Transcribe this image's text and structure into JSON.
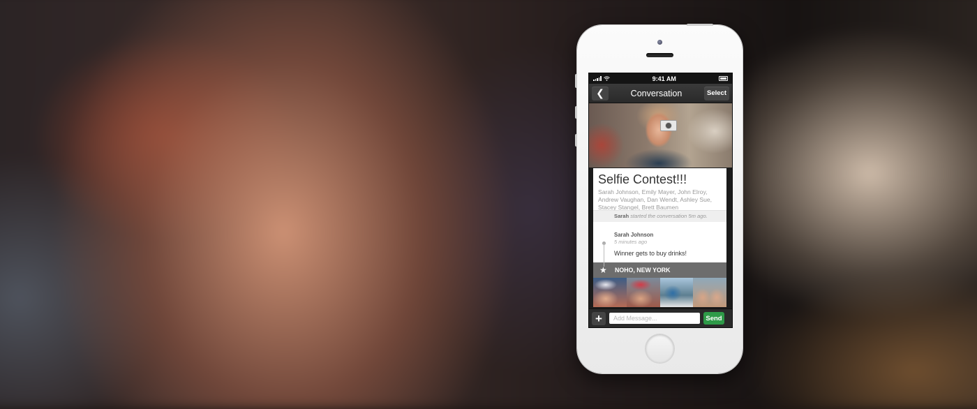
{
  "status_bar": {
    "time": "9:41 AM"
  },
  "nav": {
    "back_icon": "chevron-left-icon",
    "back_glyph": "❮",
    "title": "Conversation",
    "select_label": "Select"
  },
  "conversation": {
    "title": "Selfie Contest!!!",
    "members": "Sarah Johnson, Emily Mayer, John Elroy, Andrew Vaughan, Dan Wendt, Ashley Sue, Stacey Stangel, Brett Baumen",
    "started_by": "Sarah",
    "started_text": "started the conversation 5m ago."
  },
  "message": {
    "author": "Sarah Johnson",
    "time": "5 minutes ago",
    "text": "Winner gets to buy drinks!"
  },
  "location": {
    "icon": "star-icon",
    "glyph": "★",
    "label": "NOHO, NEW YORK"
  },
  "composer": {
    "add_glyph": "+",
    "placeholder": "Add Message...",
    "send_label": "Send"
  },
  "colors": {
    "send": "#2e9a48",
    "location_bar": "#6d6d6d",
    "nav_bar": "#2f2f2f"
  }
}
